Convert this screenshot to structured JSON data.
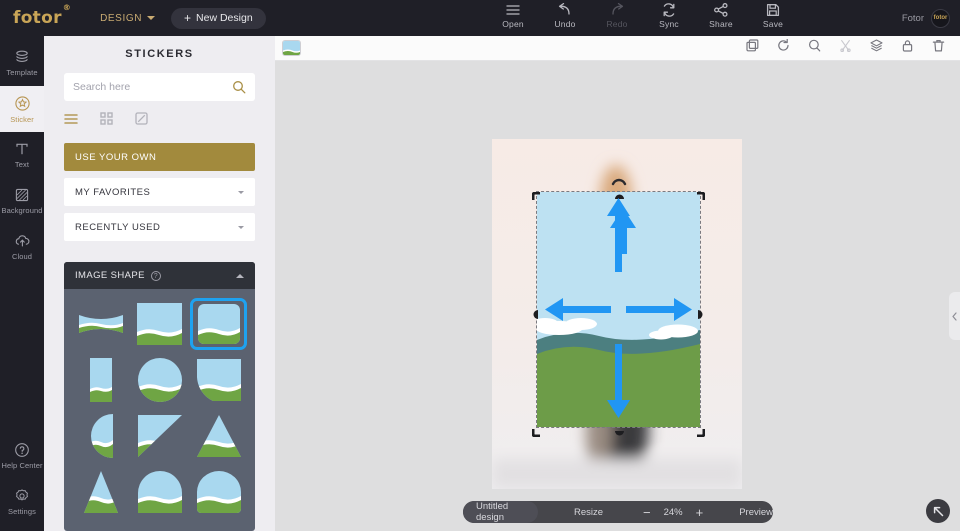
{
  "topbar": {
    "brand": "fotor",
    "brand_sup": "®",
    "design_menu": "DESIGN",
    "new_design": "New Design",
    "new_design_plus": "+",
    "actions": [
      {
        "label": "Open",
        "icon": "menu-icon",
        "disabled": false
      },
      {
        "label": "Undo",
        "icon": "undo-icon",
        "disabled": false
      },
      {
        "label": "Redo",
        "icon": "redo-icon",
        "disabled": true
      },
      {
        "label": "Sync",
        "icon": "sync-icon",
        "disabled": false
      },
      {
        "label": "Share",
        "icon": "share-icon",
        "disabled": false
      },
      {
        "label": "Save",
        "icon": "save-icon",
        "disabled": false
      }
    ],
    "user_name": "Fotor",
    "avatar_text": "fotor"
  },
  "rail": {
    "items": [
      {
        "label": "Template",
        "icon": "template-icon",
        "active": false
      },
      {
        "label": "Sticker",
        "icon": "sticker-icon",
        "active": true
      },
      {
        "label": "Text",
        "icon": "text-icon",
        "active": false
      },
      {
        "label": "Background",
        "icon": "background-icon",
        "active": false
      },
      {
        "label": "Cloud",
        "icon": "cloud-icon",
        "active": false
      }
    ],
    "bottom_items": [
      {
        "label": "Help Center",
        "icon": "help-icon"
      },
      {
        "label": "Settings",
        "icon": "settings-icon"
      }
    ]
  },
  "panel": {
    "title": "STICKERS",
    "search_placeholder": "Search here",
    "search_value": "",
    "search_icon": "search-icon",
    "view_modes": [
      {
        "icon": "list-view-icon",
        "active": true
      },
      {
        "icon": "grid-view-icon",
        "active": false
      },
      {
        "icon": "shape-view-icon",
        "active": false
      }
    ],
    "categories": [
      {
        "label": "USE YOUR OWN",
        "highlighted": true,
        "chevron": false
      },
      {
        "label": "MY FAVORITES",
        "highlighted": false,
        "chevron": true
      },
      {
        "label": "RECENTLY USED",
        "highlighted": false,
        "chevron": true
      }
    ],
    "shape_section": {
      "title": "IMAGE SHAPE",
      "help_icon": "question-mark-icon",
      "collapse_icon": "chevron-up-icon",
      "shapes": [
        {
          "name": "shape-wide-banner",
          "selected": false
        },
        {
          "name": "shape-square",
          "selected": false
        },
        {
          "name": "shape-rounded-square",
          "selected": true
        },
        {
          "name": "shape-tall-rect",
          "selected": false
        },
        {
          "name": "shape-circle",
          "selected": false
        },
        {
          "name": "shape-arch-bottom",
          "selected": false
        },
        {
          "name": "shape-half-circle",
          "selected": false
        },
        {
          "name": "shape-triangle-right",
          "selected": false
        },
        {
          "name": "shape-triangle-up",
          "selected": false
        },
        {
          "name": "shape-triangle-tall",
          "selected": false
        },
        {
          "name": "shape-arch-top",
          "selected": false
        },
        {
          "name": "shape-rounded-blob",
          "selected": false
        }
      ]
    }
  },
  "editor": {
    "tab_thumb_icon": "canvas-thumbnail",
    "canvas_tools": [
      {
        "name": "duplicate-icon",
        "disabled": false
      },
      {
        "name": "rotate-icon",
        "disabled": false
      },
      {
        "name": "zoom-icon",
        "disabled": false
      },
      {
        "name": "cut-icon",
        "disabled": true
      },
      {
        "name": "layers-icon",
        "disabled": false
      },
      {
        "name": "lock-icon",
        "disabled": false
      },
      {
        "name": "delete-icon",
        "disabled": false
      }
    ],
    "collapse_icon": "chevron-left-icon",
    "fit_icon": "fit-screen-icon"
  },
  "statusbar": {
    "design_name": "Untitled design",
    "resize_label": "Resize",
    "zoom_out": "−",
    "zoom_level": "24%",
    "zoom_in": "+",
    "preview_label": "Preview"
  },
  "colors": {
    "brand_gold": "#c9a557",
    "panel_gold": "#a28a3d",
    "selection_blue": "#1ea2f0",
    "dark_chrome": "#1f1f27",
    "panel_bg": "#eeedf1",
    "shape_bg": "#5b6270"
  }
}
